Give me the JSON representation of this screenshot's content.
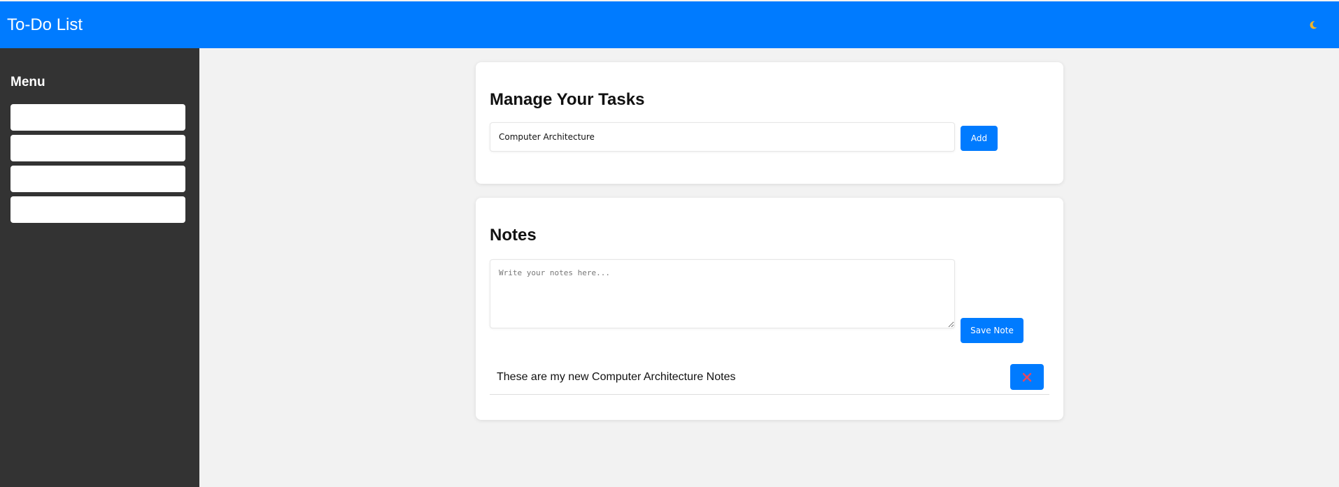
{
  "header": {
    "title": "To-Do List",
    "theme_toggle_icon": "moon-icon"
  },
  "sidebar": {
    "heading": "Menu",
    "items": [
      {
        "label": ""
      },
      {
        "label": ""
      },
      {
        "label": ""
      },
      {
        "label": ""
      }
    ]
  },
  "tasks": {
    "heading": "Manage Your Tasks",
    "input_value": "Computer Architecture",
    "add_label": "Add"
  },
  "notes": {
    "heading": "Notes",
    "placeholder": "Write your notes here...",
    "save_label": "Save Note",
    "items": [
      {
        "text": "These are my new Computer Architecture Notes",
        "delete_icon": "close-icon"
      }
    ]
  },
  "colors": {
    "primary": "#007bff",
    "sidebar": "#333333",
    "background": "#f2f2f2",
    "delete_icon": "#e8475f",
    "moon": "#f0b429"
  }
}
